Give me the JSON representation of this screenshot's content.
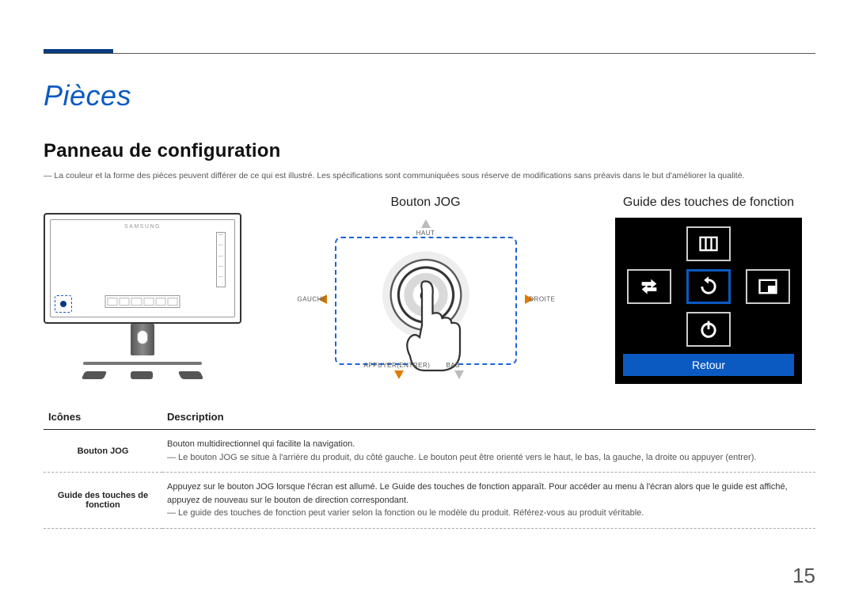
{
  "page_number": "15",
  "section_title": "Pièces",
  "subsection_title": "Panneau de configuration",
  "top_note": "―  La couleur et la forme des pièces peuvent différer de ce qui est illustré. Les spécifications sont communiquées sous réserve de modifications sans préavis dans le but d'améliorer la qualité.",
  "monitor_brand": "SAMSUNG",
  "jog": {
    "title": "Bouton JOG",
    "labels": {
      "up": "HAUT",
      "down": "BAS",
      "left": "GAUCHE",
      "right": "DROITE",
      "press": "APPUYER(ENTRER)"
    }
  },
  "function_guide": {
    "title": "Guide des touches de fonction",
    "return_label": "Retour",
    "icons": {
      "top": "menu-icon",
      "left": "source-icon",
      "center": "refresh-icon",
      "right": "pip-icon",
      "bottom": "power-icon"
    }
  },
  "table": {
    "headers": {
      "icon": "Icônes",
      "desc": "Description"
    },
    "rows": [
      {
        "icon_label": "Bouton JOG",
        "desc_main": "Bouton multidirectionnel qui facilite la navigation.",
        "desc_note": "―  Le bouton JOG se situe à l'arrière du produit, du côté gauche. Le bouton peut être orienté vers le haut, le bas, la gauche, la droite ou appuyer (entrer)."
      },
      {
        "icon_label": "Guide des touches de fonction",
        "desc_main": "Appuyez sur le bouton JOG lorsque l'écran est allumé. Le Guide des touches de fonction apparaît. Pour accéder au menu à l'écran alors que le guide est affiché, appuyez de nouveau sur le bouton de direction correspondant.",
        "desc_note": "―  Le guide des touches de fonction peut varier selon la fonction ou le modèle du produit. Référez-vous au produit véritable."
      }
    ]
  }
}
